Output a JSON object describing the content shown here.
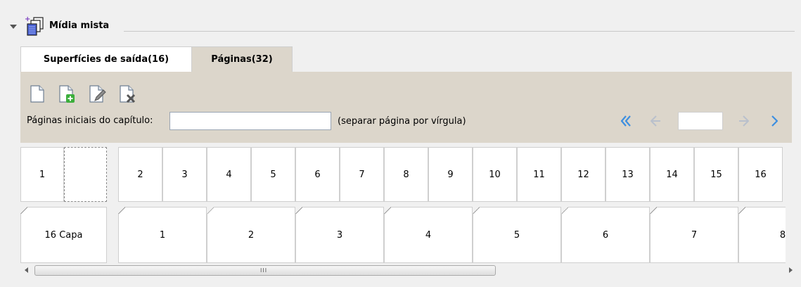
{
  "section": {
    "title": "Mídia mista",
    "icon": "mixed-media-icon",
    "collapse_icon": "triangle-down-icon"
  },
  "tabs": [
    {
      "label": "Superfícies de saída(16)",
      "active": false
    },
    {
      "label": "Páginas(32)",
      "active": true
    }
  ],
  "toolbar": {
    "tools": [
      {
        "name": "new-page-icon"
      },
      {
        "name": "add-page-icon"
      },
      {
        "name": "edit-page-icon"
      },
      {
        "name": "delete-page-icon"
      }
    ],
    "chapter_label": "Páginas iniciais do capítulo:",
    "chapter_value": "",
    "separator_hint": "(separar página por vírgula)",
    "page_value": ""
  },
  "colors": {
    "toolbar_bg": "#dcd6cb",
    "nav_active": "#3d8fe0",
    "nav_disabled": "#b9c0cc"
  },
  "page_row": [
    "1",
    "",
    "2",
    "3",
    "4",
    "5",
    "6",
    "7",
    "8",
    "9",
    "10",
    "11",
    "12",
    "13",
    "14",
    "15",
    "16"
  ],
  "sheet_row": [
    "16 Capa",
    "1",
    "2",
    "3",
    "4",
    "5",
    "6",
    "7",
    "8"
  ],
  "scrollbar": {
    "grip": "III"
  }
}
